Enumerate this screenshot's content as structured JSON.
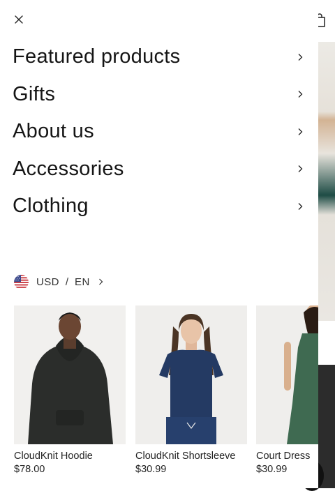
{
  "menu": {
    "items": [
      {
        "label": "Featured products"
      },
      {
        "label": "Gifts"
      },
      {
        "label": "About us"
      },
      {
        "label": "Accessories"
      },
      {
        "label": "Clothing"
      }
    ]
  },
  "locale": {
    "currency": "USD",
    "separator": "/",
    "language": "EN",
    "flag_icon": "us-flag-icon"
  },
  "products": [
    {
      "name": "CloudKnit Hoodie",
      "price": "$78.00"
    },
    {
      "name": "CloudKnit Shortsleeve",
      "price": "$30.99"
    },
    {
      "name": "Court Dress",
      "price": "$30.99"
    }
  ],
  "colors": {
    "text": "#151515",
    "hoodie": "#2b2d2b",
    "tee": "#243a63",
    "dress": "#3f6a51",
    "image_bg": "#efeeec"
  }
}
